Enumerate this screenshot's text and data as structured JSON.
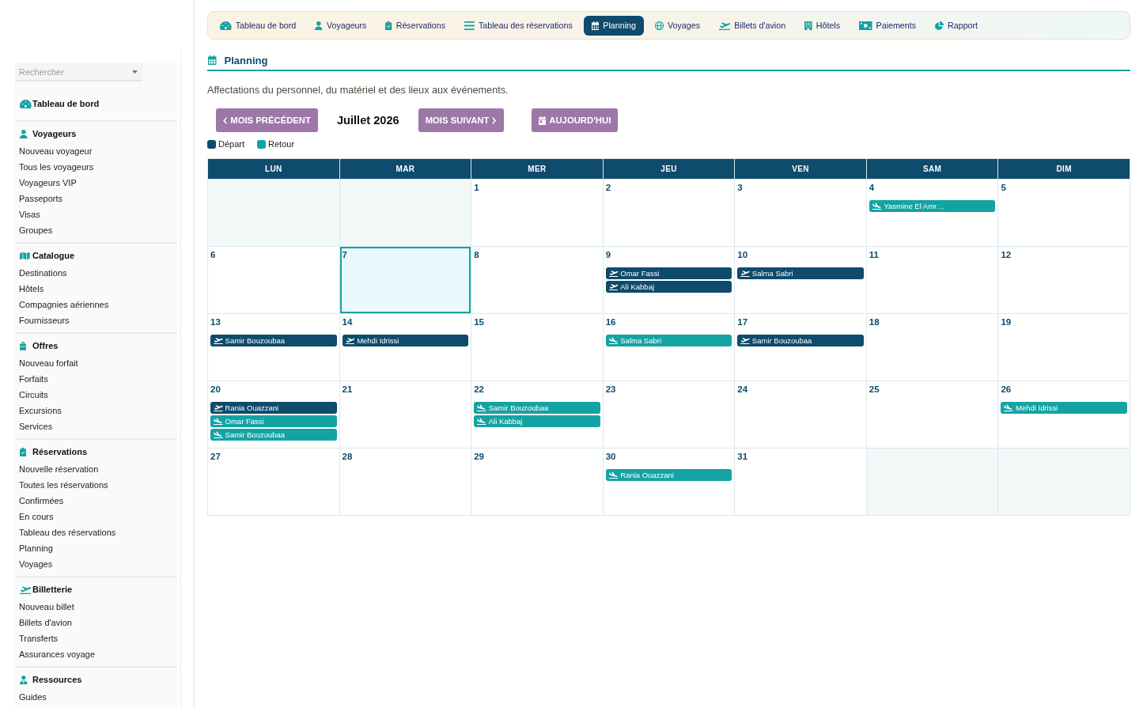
{
  "sidebar": {
    "search": {
      "placeholder": "Rechercher"
    },
    "sections": [
      {
        "title": "Tableau de bord"
      },
      {
        "title": "Voyageurs",
        "items": [
          "Nouveau voyageur",
          "Tous les voyageurs",
          "Voyageurs VIP",
          "Passeports",
          "Visas",
          "Groupes"
        ]
      },
      {
        "title": "Catalogue",
        "items": [
          "Destinations",
          "Hôtels",
          "Compagnies aériennes",
          "Fournisseurs"
        ]
      },
      {
        "title": "Offres",
        "items": [
          "Nouveau forfait",
          "Forfaits",
          "Circuits",
          "Excursions",
          "Services"
        ]
      },
      {
        "title": "Réservations",
        "items": [
          "Nouvelle réservation",
          "Toutes les réservations",
          "Confirmées",
          "En cours",
          "Tableau des réservations",
          "Planning",
          "Voyages"
        ]
      },
      {
        "title": "Billetterie",
        "items": [
          "Nouveau billet",
          "Billets d'avion",
          "Transferts",
          "Assurances voyage"
        ]
      },
      {
        "title": "Ressources",
        "items": [
          "Guides"
        ]
      }
    ]
  },
  "nav": {
    "tabs": [
      {
        "label": "Tableau de bord",
        "selected": false
      },
      {
        "label": "Voyageurs",
        "selected": false
      },
      {
        "label": "Réservations",
        "selected": false
      },
      {
        "label": "Tableau des réservations",
        "selected": false
      },
      {
        "label": "Planning",
        "selected": true
      },
      {
        "label": "Voyages",
        "selected": false
      },
      {
        "label": "Billets d'avion",
        "selected": false
      },
      {
        "label": "Hôtels",
        "selected": false
      },
      {
        "label": "Paiements",
        "selected": false
      },
      {
        "label": "Rapport",
        "selected": false
      }
    ]
  },
  "page": {
    "title": "Planning",
    "description": "Affectations du personnel, du matériel et des lieux aux événements."
  },
  "toolbar": {
    "previous_button": "MOIS PRÉCÉDENT",
    "month": "Juillet 2026",
    "next_button": "MOIS SUIVANT",
    "today_button": "AUJOURD'HUI"
  },
  "legend": [
    {
      "kind": "departure",
      "label": "Départ",
      "color": "#0e4b6c"
    },
    {
      "kind": "return",
      "label": "Retour",
      "color": "#14a3a3"
    }
  ],
  "calendar": {
    "weekdays": [
      "LUN",
      "MAR",
      "MER",
      "JEU",
      "VEN",
      "SAM",
      "DIM"
    ],
    "weeks": [
      {
        "days": [
          {
            "in_month": false,
            "today": false
          },
          {
            "in_month": false,
            "today": false
          },
          {
            "day": "1",
            "in_month": true,
            "today": false
          },
          {
            "day": "2",
            "in_month": true,
            "today": false
          },
          {
            "day": "3",
            "in_month": true,
            "today": false
          },
          {
            "day": "4",
            "in_month": true,
            "today": false,
            "events": [
              {
                "name": "Yasmine El Amr…",
                "kind": "return"
              }
            ]
          },
          {
            "day": "5",
            "in_month": true,
            "today": false
          }
        ]
      },
      {
        "days": [
          {
            "day": "6",
            "in_month": true,
            "today": false
          },
          {
            "day": "7",
            "in_month": true,
            "today": true
          },
          {
            "day": "8",
            "in_month": true,
            "today": false
          },
          {
            "day": "9",
            "in_month": true,
            "today": false,
            "events": [
              {
                "name": "Omar Fassi",
                "kind": "departure"
              },
              {
                "name": "Ali Kabbaj",
                "kind": "departure"
              }
            ]
          },
          {
            "day": "10",
            "in_month": true,
            "today": false,
            "events": [
              {
                "name": "Salma Sabri",
                "kind": "departure"
              }
            ]
          },
          {
            "day": "11",
            "in_month": true,
            "today": false
          },
          {
            "day": "12",
            "in_month": true,
            "today": false
          }
        ]
      },
      {
        "days": [
          {
            "day": "13",
            "in_month": true,
            "today": false,
            "events": [
              {
                "name": "Samir Bouzoubaa",
                "kind": "departure"
              }
            ]
          },
          {
            "day": "14",
            "in_month": true,
            "today": false,
            "events": [
              {
                "name": "Mehdi Idrissi",
                "kind": "departure"
              }
            ]
          },
          {
            "day": "15",
            "in_month": true,
            "today": false
          },
          {
            "day": "16",
            "in_month": true,
            "today": false,
            "events": [
              {
                "name": "Salma Sabri",
                "kind": "return"
              }
            ]
          },
          {
            "day": "17",
            "in_month": true,
            "today": false,
            "events": [
              {
                "name": "Samir Bouzoubaa",
                "kind": "departure"
              }
            ]
          },
          {
            "day": "18",
            "in_month": true,
            "today": false
          },
          {
            "day": "19",
            "in_month": true,
            "today": false
          }
        ]
      },
      {
        "days": [
          {
            "day": "20",
            "in_month": true,
            "today": false,
            "events": [
              {
                "name": "Rania Ouazzani",
                "kind": "departure"
              },
              {
                "name": "Omar Fassi",
                "kind": "return"
              },
              {
                "name": "Samir Bouzoubaa",
                "kind": "return"
              }
            ]
          },
          {
            "day": "21",
            "in_month": true,
            "today": false
          },
          {
            "day": "22",
            "in_month": true,
            "today": false,
            "events": [
              {
                "name": "Samir Bouzoubaa",
                "kind": "return"
              },
              {
                "name": "Ali Kabbaj",
                "kind": "return"
              }
            ]
          },
          {
            "day": "23",
            "in_month": true,
            "today": false
          },
          {
            "day": "24",
            "in_month": true,
            "today": false
          },
          {
            "day": "25",
            "in_month": true,
            "today": false
          },
          {
            "day": "26",
            "in_month": true,
            "today": false,
            "events": [
              {
                "name": "Mehdi Idrissi",
                "kind": "return"
              }
            ]
          }
        ]
      },
      {
        "days": [
          {
            "day": "27",
            "in_month": true,
            "today": false
          },
          {
            "day": "28",
            "in_month": true,
            "today": false
          },
          {
            "day": "29",
            "in_month": true,
            "today": false
          },
          {
            "day": "30",
            "in_month": true,
            "today": false,
            "events": [
              {
                "name": "Rania Ouazzani",
                "kind": "return"
              }
            ]
          },
          {
            "day": "31",
            "in_month": true,
            "today": false
          },
          {
            "in_month": false,
            "today": false
          },
          {
            "in_month": false,
            "today": false
          }
        ]
      }
    ]
  }
}
